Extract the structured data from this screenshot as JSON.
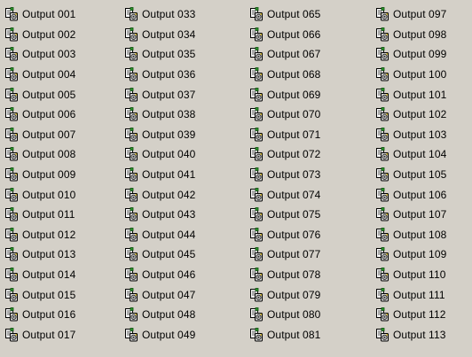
{
  "icon": "output-port-icon",
  "columns": [
    {
      "items": [
        "Output 001",
        "Output 002",
        "Output 003",
        "Output 004",
        "Output 005",
        "Output 006",
        "Output 007",
        "Output 008",
        "Output 009",
        "Output 010",
        "Output 011",
        "Output 012",
        "Output 013",
        "Output 014",
        "Output 015",
        "Output 016",
        "Output 017"
      ]
    },
    {
      "items": [
        "Output 033",
        "Output 034",
        "Output 035",
        "Output 036",
        "Output 037",
        "Output 038",
        "Output 039",
        "Output 040",
        "Output 041",
        "Output 042",
        "Output 043",
        "Output 044",
        "Output 045",
        "Output 046",
        "Output 047",
        "Output 048",
        "Output 049"
      ]
    },
    {
      "items": [
        "Output 065",
        "Output 066",
        "Output 067",
        "Output 068",
        "Output 069",
        "Output 070",
        "Output 071",
        "Output 072",
        "Output 073",
        "Output 074",
        "Output 075",
        "Output 076",
        "Output 077",
        "Output 078",
        "Output 079",
        "Output 080",
        "Output 081"
      ]
    },
    {
      "items": [
        "Output 097",
        "Output 098",
        "Output 099",
        "Output 100",
        "Output 101",
        "Output 102",
        "Output 103",
        "Output 104",
        "Output 105",
        "Output 106",
        "Output 107",
        "Output 108",
        "Output 109",
        "Output 110",
        "Output 111",
        "Output 112",
        "Output 113"
      ]
    }
  ]
}
